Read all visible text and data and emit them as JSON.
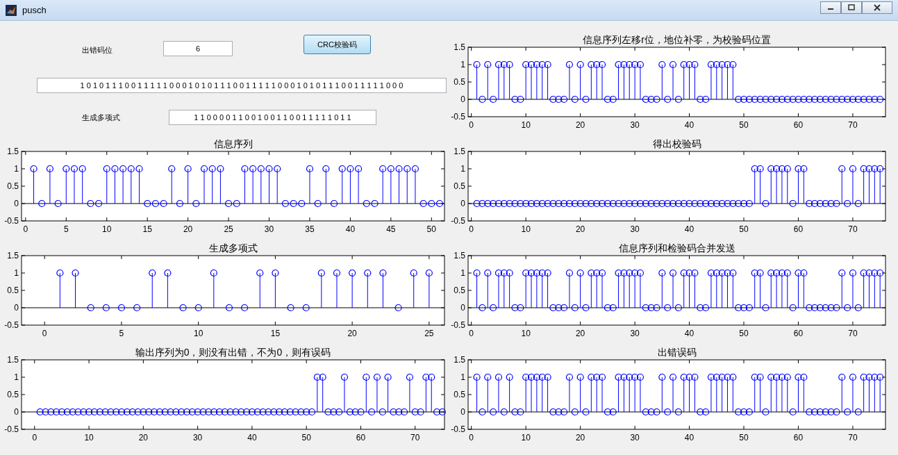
{
  "window": {
    "title": "pusch"
  },
  "left_panel": {
    "error_bit": {
      "label": "出错码位",
      "value": "6"
    },
    "crc_button": {
      "label": "CRC校验码"
    },
    "info_field": {
      "value": "1 0 1 0 1 1 1 0 0 1 1 1 1 1 0 0 0 1 0 1 0 1 1 1 0 0 1 1 1 1 1 0 0 0 1 0 1 0 1 1 1 0 0 1 1 1 1 1 0 0 0"
    },
    "polynomial": {
      "label": "生成多项式",
      "value": "1 1 0 0 0 0 1 1 0 0 1 0 0 1 1 0 0 1 1 1 1 1 0 1 1"
    },
    "charts": [
      {
        "chart_data": {
          "type": "bar",
          "title": "信息序列",
          "xlim": [
            -0.5,
            51.6
          ],
          "ylim": [
            -0.5,
            1.5
          ],
          "xticks": [
            0,
            5,
            10,
            15,
            20,
            25,
            30,
            35,
            40,
            45,
            50
          ],
          "yticks": [
            -0.5,
            0,
            0.5,
            1,
            1.5
          ],
          "x": [
            1,
            2,
            3,
            4,
            5,
            6,
            7,
            8,
            9,
            10,
            11,
            12,
            13,
            14,
            15,
            16,
            17,
            18,
            19,
            20,
            21,
            22,
            23,
            24,
            25,
            26,
            27,
            28,
            29,
            30,
            31,
            32,
            33,
            34,
            35,
            36,
            37,
            38,
            39,
            40,
            41,
            42,
            43,
            44,
            45,
            46,
            47,
            48,
            49,
            50,
            51
          ],
          "series": [
            {
              "color": "#0000ff",
              "values": [
                1,
                0,
                1,
                0,
                1,
                1,
                1,
                0,
                0,
                1,
                1,
                1,
                1,
                1,
                0,
                0,
                0,
                1,
                0,
                1,
                0,
                1,
                1,
                1,
                0,
                0,
                1,
                1,
                1,
                1,
                1,
                0,
                0,
                0,
                1,
                0,
                1,
                0,
                1,
                1,
                1,
                0,
                0,
                1,
                1,
                1,
                1,
                1,
                0,
                0,
                0
              ]
            }
          ]
        }
      },
      {
        "chart_data": {
          "type": "bar",
          "title": "生成多项式",
          "xlim": [
            -1.5,
            26
          ],
          "ylim": [
            -0.5,
            1.5
          ],
          "xticks": [
            0,
            5,
            10,
            15,
            20,
            25
          ],
          "yticks": [
            -0.5,
            0,
            0.5,
            1,
            1.5
          ],
          "x": [
            1,
            2,
            3,
            4,
            5,
            6,
            7,
            8,
            9,
            10,
            11,
            12,
            13,
            14,
            15,
            16,
            17,
            18,
            19,
            20,
            21,
            22,
            23,
            24,
            25
          ],
          "series": [
            {
              "color": "#0000ff",
              "values": [
                1,
                1,
                0,
                0,
                0,
                0,
                1,
                1,
                0,
                0,
                1,
                0,
                0,
                1,
                1,
                0,
                0,
                1,
                1,
                1,
                1,
                1,
                0,
                1,
                1
              ]
            }
          ]
        }
      },
      {
        "chart_data": {
          "type": "bar",
          "title": "输出序列为0，则没有出错，不为0，则有误码",
          "xlim": [
            -2.4,
            75.4
          ],
          "ylim": [
            -0.5,
            1.5
          ],
          "xticks": [
            0,
            10,
            20,
            30,
            40,
            50,
            60,
            70
          ],
          "yticks": [
            -0.5,
            0,
            0.5,
            1,
            1.5
          ],
          "x": [
            1,
            2,
            3,
            4,
            5,
            6,
            7,
            8,
            9,
            10,
            11,
            12,
            13,
            14,
            15,
            16,
            17,
            18,
            19,
            20,
            21,
            22,
            23,
            24,
            25,
            26,
            27,
            28,
            29,
            30,
            31,
            32,
            33,
            34,
            35,
            36,
            37,
            38,
            39,
            40,
            41,
            42,
            43,
            44,
            45,
            46,
            47,
            48,
            49,
            50,
            51,
            52,
            53,
            54,
            55,
            56,
            57,
            58,
            59,
            60,
            61,
            62,
            63,
            64,
            65,
            66,
            67,
            68,
            69,
            70,
            71,
            72,
            73,
            74,
            75
          ],
          "series": [
            {
              "color": "#0000ff",
              "values": [
                0,
                0,
                0,
                0,
                0,
                0,
                0,
                0,
                0,
                0,
                0,
                0,
                0,
                0,
                0,
                0,
                0,
                0,
                0,
                0,
                0,
                0,
                0,
                0,
                0,
                0,
                0,
                0,
                0,
                0,
                0,
                0,
                0,
                0,
                0,
                0,
                0,
                0,
                0,
                0,
                0,
                0,
                0,
                0,
                0,
                0,
                0,
                0,
                0,
                0,
                0,
                1,
                1,
                0,
                0,
                0,
                1,
                0,
                0,
                0,
                1,
                0,
                1,
                0,
                1,
                0,
                0,
                0,
                1,
                0,
                0,
                1,
                1,
                0,
                0
              ]
            }
          ]
        }
      }
    ]
  },
  "right_panel": {
    "charts": [
      {
        "chart_data": {
          "type": "bar",
          "title": "信息序列左移r位，地位补零，为校验码位置",
          "xlim": [
            -0.6,
            76
          ],
          "ylim": [
            -0.5,
            1.5
          ],
          "xticks": [
            0,
            10,
            20,
            30,
            40,
            50,
            60,
            70
          ],
          "yticks": [
            -0.5,
            0,
            0.5,
            1,
            1.5
          ],
          "x": [
            1,
            2,
            3,
            4,
            5,
            6,
            7,
            8,
            9,
            10,
            11,
            12,
            13,
            14,
            15,
            16,
            17,
            18,
            19,
            20,
            21,
            22,
            23,
            24,
            25,
            26,
            27,
            28,
            29,
            30,
            31,
            32,
            33,
            34,
            35,
            36,
            37,
            38,
            39,
            40,
            41,
            42,
            43,
            44,
            45,
            46,
            47,
            48,
            49,
            50,
            51,
            52,
            53,
            54,
            55,
            56,
            57,
            58,
            59,
            60,
            61,
            62,
            63,
            64,
            65,
            66,
            67,
            68,
            69,
            70,
            71,
            72,
            73,
            74,
            75
          ],
          "series": [
            {
              "color": "#0000ff",
              "values": [
                1,
                0,
                1,
                0,
                1,
                1,
                1,
                0,
                0,
                1,
                1,
                1,
                1,
                1,
                0,
                0,
                0,
                1,
                0,
                1,
                0,
                1,
                1,
                1,
                0,
                0,
                1,
                1,
                1,
                1,
                1,
                0,
                0,
                0,
                1,
                0,
                1,
                0,
                1,
                1,
                1,
                0,
                0,
                1,
                1,
                1,
                1,
                1,
                0,
                0,
                0,
                0,
                0,
                0,
                0,
                0,
                0,
                0,
                0,
                0,
                0,
                0,
                0,
                0,
                0,
                0,
                0,
                0,
                0,
                0,
                0,
                0,
                0,
                0,
                0
              ]
            }
          ]
        }
      },
      {
        "chart_data": {
          "type": "bar",
          "title": "得出校验码",
          "xlim": [
            -0.6,
            76
          ],
          "ylim": [
            -0.5,
            1.5
          ],
          "xticks": [
            0,
            10,
            20,
            30,
            40,
            50,
            60,
            70
          ],
          "yticks": [
            -0.5,
            0,
            0.5,
            1,
            1.5
          ],
          "x": [
            1,
            2,
            3,
            4,
            5,
            6,
            7,
            8,
            9,
            10,
            11,
            12,
            13,
            14,
            15,
            16,
            17,
            18,
            19,
            20,
            21,
            22,
            23,
            24,
            25,
            26,
            27,
            28,
            29,
            30,
            31,
            32,
            33,
            34,
            35,
            36,
            37,
            38,
            39,
            40,
            41,
            42,
            43,
            44,
            45,
            46,
            47,
            48,
            49,
            50,
            51,
            52,
            53,
            54,
            55,
            56,
            57,
            58,
            59,
            60,
            61,
            62,
            63,
            64,
            65,
            66,
            67,
            68,
            69,
            70,
            71,
            72,
            73,
            74,
            75
          ],
          "series": [
            {
              "color": "#0000ff",
              "values": [
                0,
                0,
                0,
                0,
                0,
                0,
                0,
                0,
                0,
                0,
                0,
                0,
                0,
                0,
                0,
                0,
                0,
                0,
                0,
                0,
                0,
                0,
                0,
                0,
                0,
                0,
                0,
                0,
                0,
                0,
                0,
                0,
                0,
                0,
                0,
                0,
                0,
                0,
                0,
                0,
                0,
                0,
                0,
                0,
                0,
                0,
                0,
                0,
                0,
                0,
                0,
                1,
                1,
                0,
                1,
                1,
                1,
                1,
                0,
                1,
                1,
                0,
                0,
                0,
                0,
                0,
                0,
                1,
                0,
                1,
                0,
                1,
                1,
                1,
                1
              ]
            }
          ]
        }
      },
      {
        "chart_data": {
          "type": "bar",
          "title": "信息序列和检验码合并发送",
          "xlim": [
            -0.6,
            76
          ],
          "ylim": [
            -0.5,
            1.5
          ],
          "xticks": [
            0,
            10,
            20,
            30,
            40,
            50,
            60,
            70
          ],
          "yticks": [
            -0.5,
            0,
            0.5,
            1,
            1.5
          ],
          "x": [
            1,
            2,
            3,
            4,
            5,
            6,
            7,
            8,
            9,
            10,
            11,
            12,
            13,
            14,
            15,
            16,
            17,
            18,
            19,
            20,
            21,
            22,
            23,
            24,
            25,
            26,
            27,
            28,
            29,
            30,
            31,
            32,
            33,
            34,
            35,
            36,
            37,
            38,
            39,
            40,
            41,
            42,
            43,
            44,
            45,
            46,
            47,
            48,
            49,
            50,
            51,
            52,
            53,
            54,
            55,
            56,
            57,
            58,
            59,
            60,
            61,
            62,
            63,
            64,
            65,
            66,
            67,
            68,
            69,
            70,
            71,
            72,
            73,
            74,
            75
          ],
          "series": [
            {
              "color": "#0000ff",
              "values": [
                1,
                0,
                1,
                0,
                1,
                1,
                1,
                0,
                0,
                1,
                1,
                1,
                1,
                1,
                0,
                0,
                0,
                1,
                0,
                1,
                0,
                1,
                1,
                1,
                0,
                0,
                1,
                1,
                1,
                1,
                1,
                0,
                0,
                0,
                1,
                0,
                1,
                0,
                1,
                1,
                1,
                0,
                0,
                1,
                1,
                1,
                1,
                1,
                0,
                0,
                0,
                1,
                1,
                0,
                1,
                1,
                1,
                1,
                0,
                1,
                1,
                0,
                0,
                0,
                0,
                0,
                0,
                1,
                0,
                1,
                0,
                1,
                1,
                1,
                1
              ]
            }
          ]
        }
      },
      {
        "chart_data": {
          "type": "bar",
          "title": "出错误码",
          "xlim": [
            -0.6,
            76
          ],
          "ylim": [
            -0.5,
            1.5
          ],
          "xticks": [
            0,
            10,
            20,
            30,
            40,
            50,
            60,
            70
          ],
          "yticks": [
            -0.5,
            0,
            0.5,
            1,
            1.5
          ],
          "x": [
            1,
            2,
            3,
            4,
            5,
            6,
            7,
            8,
            9,
            10,
            11,
            12,
            13,
            14,
            15,
            16,
            17,
            18,
            19,
            20,
            21,
            22,
            23,
            24,
            25,
            26,
            27,
            28,
            29,
            30,
            31,
            32,
            33,
            34,
            35,
            36,
            37,
            38,
            39,
            40,
            41,
            42,
            43,
            44,
            45,
            46,
            47,
            48,
            49,
            50,
            51,
            52,
            53,
            54,
            55,
            56,
            57,
            58,
            59,
            60,
            61,
            62,
            63,
            64,
            65,
            66,
            67,
            68,
            69,
            70,
            71,
            72,
            73,
            74,
            75
          ],
          "series": [
            {
              "color": "#0000ff",
              "values": [
                1,
                0,
                1,
                0,
                1,
                0,
                1,
                0,
                0,
                1,
                1,
                1,
                1,
                1,
                0,
                0,
                0,
                1,
                0,
                1,
                0,
                1,
                1,
                1,
                0,
                0,
                1,
                1,
                1,
                1,
                1,
                0,
                0,
                0,
                1,
                0,
                1,
                0,
                1,
                1,
                1,
                0,
                0,
                1,
                1,
                1,
                1,
                1,
                0,
                0,
                0,
                1,
                1,
                0,
                1,
                1,
                1,
                1,
                0,
                1,
                1,
                0,
                0,
                0,
                0,
                0,
                0,
                1,
                0,
                1,
                0,
                1,
                1,
                1,
                1
              ]
            }
          ]
        }
      }
    ]
  }
}
